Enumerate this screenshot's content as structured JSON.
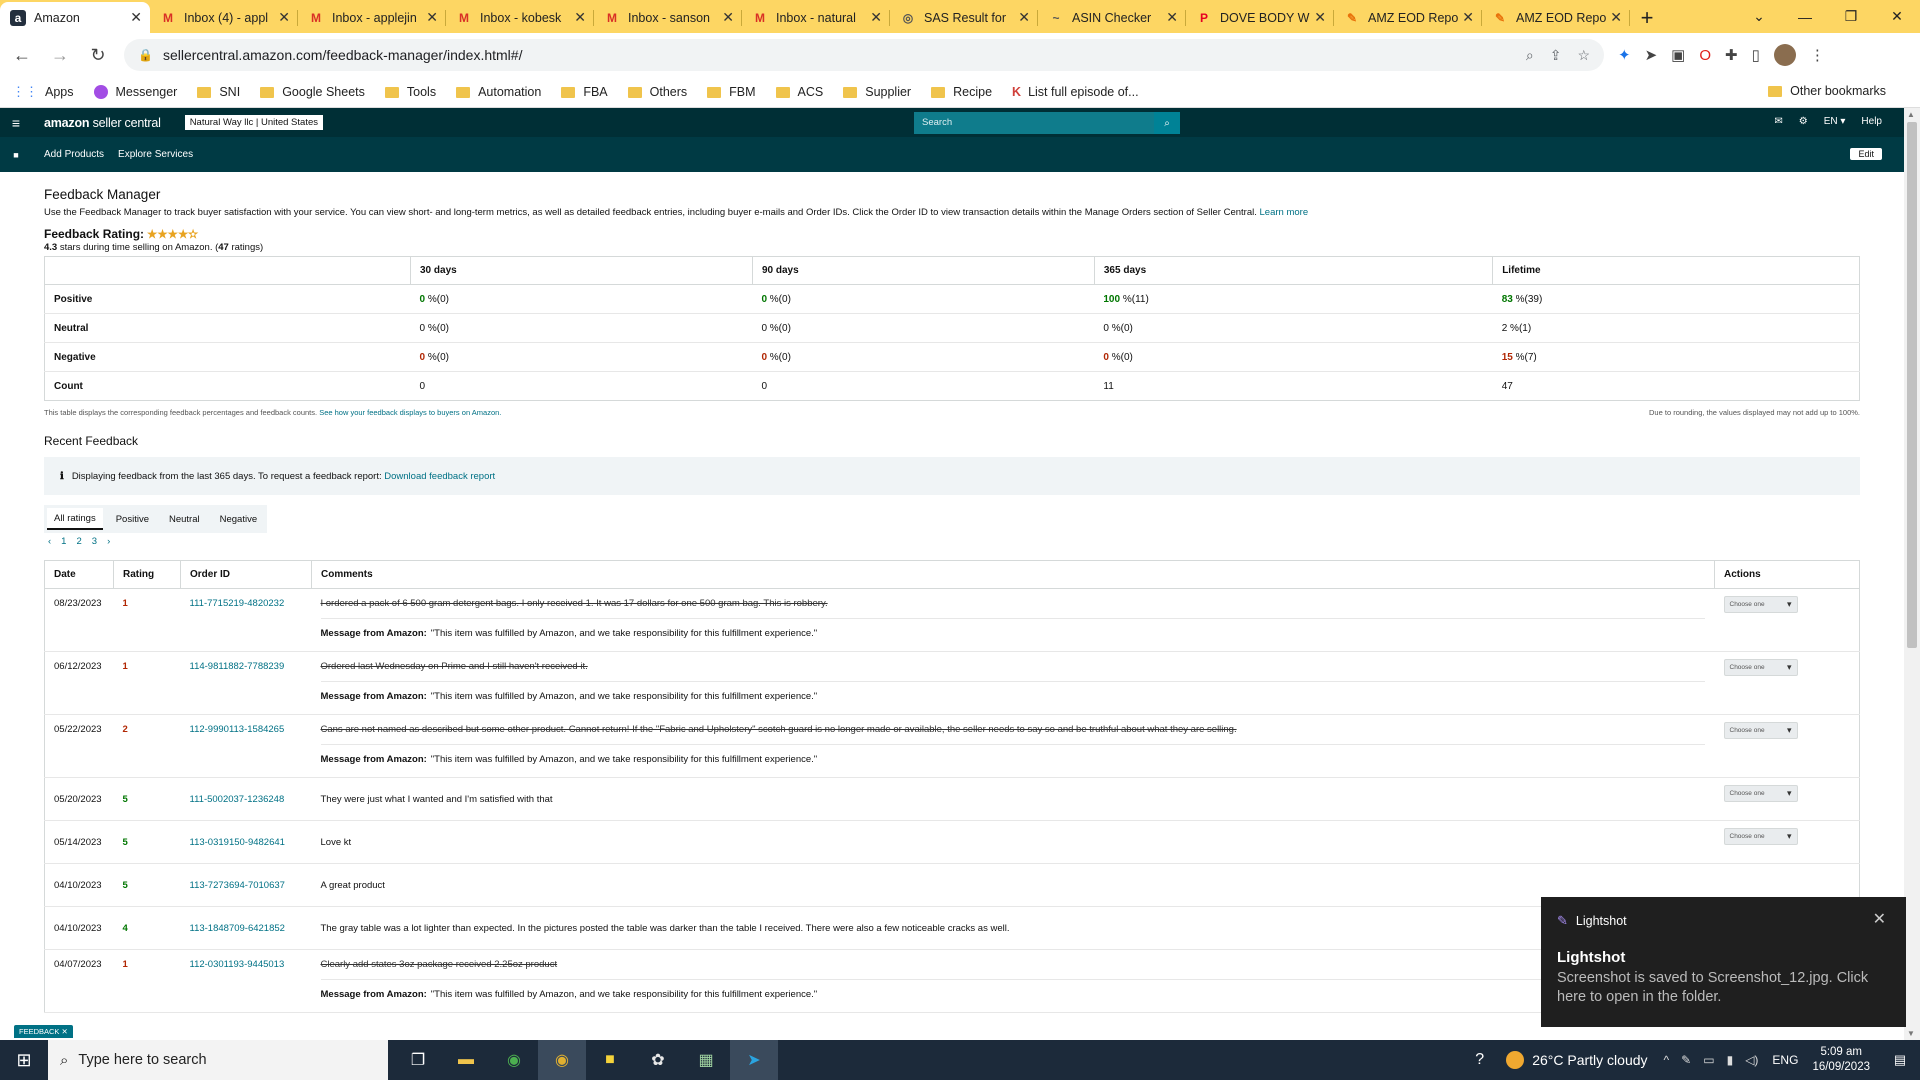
{
  "browser": {
    "tabs": [
      {
        "title": "Amazon",
        "icon": "amazon-favicon",
        "active": true
      },
      {
        "title": "Inbox (4) - appl",
        "icon": "gmail-icon"
      },
      {
        "title": "Inbox - applejin",
        "icon": "gmail-icon"
      },
      {
        "title": "Inbox - kobesk",
        "icon": "gmail-icon"
      },
      {
        "title": "Inbox - sanson",
        "icon": "gmail-icon"
      },
      {
        "title": "Inbox - natural",
        "icon": "gmail-icon"
      },
      {
        "title": "SAS Result for",
        "icon": "sas-icon"
      },
      {
        "title": "ASIN Checker",
        "icon": "asin-icon"
      },
      {
        "title": "DOVE BODY W",
        "icon": "pinterest-icon"
      },
      {
        "title": "AMZ EOD Repo",
        "icon": "sheets-icon"
      },
      {
        "title": "AMZ EOD Repo",
        "icon": "sheets-icon"
      }
    ],
    "url": "sellercentral.amazon.com/feedback-manager/index.html#/",
    "bookmarks": [
      "Apps",
      "Messenger",
      "SNI",
      "Google Sheets",
      "Tools",
      "Automation",
      "FBA",
      "Others",
      "FBM",
      "ACS",
      "Supplier",
      "Recipe",
      "List full episode of..."
    ],
    "other_bookmarks": "Other bookmarks"
  },
  "seller_header": {
    "logo_bold": "amazon",
    "logo_rest": " seller central",
    "account": "Natural Way llc | United States",
    "search_placeholder": "Search",
    "lang": "EN ▾",
    "help": "Help",
    "nav": [
      "Add Products",
      "Explore Services"
    ],
    "edit": "Edit"
  },
  "feedback_manager": {
    "title": "Feedback Manager",
    "description": "Use the Feedback Manager to track buyer satisfaction with your service. You can view short- and long-term metrics, as well as detailed feedback entries, including buyer e-mails and Order IDs. Click the Order ID to view transaction details within the Manage Orders section of Seller Central.",
    "learn_more": "Learn more",
    "rating_label": "Feedback Rating:",
    "rating_stars": 4.3,
    "rating_stars_glyphs": "★★★★✫",
    "rating_sub_value": "4.3",
    "rating_sub_text": " stars during time selling on Amazon. (",
    "rating_count": "47",
    "rating_sub_end": " ratings)"
  },
  "metrics": {
    "columns": [
      "30 days",
      "90 days",
      "365 days",
      "Lifetime"
    ],
    "rows": [
      {
        "label": "Positive",
        "cells": [
          [
            "0",
            "%(0)",
            "g"
          ],
          [
            "0",
            "%(0)",
            "g"
          ],
          [
            "100",
            "%(11)",
            "g"
          ],
          [
            "83",
            "%(39)",
            "g"
          ]
        ]
      },
      {
        "label": "Neutral",
        "cells": [
          [
            "0",
            "%(0)",
            ""
          ],
          [
            "0",
            "%(0)",
            ""
          ],
          [
            "0",
            "%(0)",
            ""
          ],
          [
            "2",
            "%(1)",
            ""
          ]
        ]
      },
      {
        "label": "Negative",
        "cells": [
          [
            "0",
            "%(0)",
            "r"
          ],
          [
            "0",
            "%(0)",
            "r"
          ],
          [
            "0",
            "%(0)",
            "r"
          ],
          [
            "15",
            "%(7)",
            "r"
          ]
        ]
      },
      {
        "label": "Count",
        "cells": [
          [
            "0",
            "",
            ""
          ],
          [
            "0",
            "",
            ""
          ],
          [
            "11",
            "",
            ""
          ],
          [
            "47",
            "",
            ""
          ]
        ]
      }
    ],
    "note": "This table displays the corresponding feedback percentages and feedback counts.",
    "note_link": "See how your feedback displays to buyers on Amazon.",
    "rounding": "Due to rounding, the values displayed may not add up to 100%."
  },
  "recent_feedback": {
    "title": "Recent Feedback",
    "info": "Displaying feedback from the last 365 days. To request a feedback report:",
    "info_link": "Download feedback report",
    "tabs": [
      "All ratings",
      "Positive",
      "Neutral",
      "Negative"
    ],
    "pager": [
      "‹",
      "1",
      "2",
      "3",
      "›"
    ],
    "columns": [
      "Date",
      "Rating",
      "Order ID",
      "Comments",
      "Actions"
    ],
    "amazon_msg_label": "Message from Amazon:",
    "amazon_msg": "\"This item was fulfilled by Amazon, and we take responsibility for this fulfillment experience.\"",
    "choose": "Choose one",
    "rows": [
      {
        "date": "08/23/2023",
        "rating": "1",
        "order": "111-7715219-4820232",
        "comment": "I ordered a pack of 6 500 gram detergent bags. I only received 1. It was 17 dollars for one 500 gram bag. This is robbery.",
        "struck": true,
        "amz": true,
        "action": true
      },
      {
        "date": "06/12/2023",
        "rating": "1",
        "order": "114-9811882-7788239",
        "comment": "Ordered last Wednesday on Prime and I still haven't received it.",
        "struck": true,
        "amz": true,
        "action": true
      },
      {
        "date": "05/22/2023",
        "rating": "2",
        "order": "112-9990113-1584265",
        "comment": "Cans are not named as described but some other product. Cannot return! If the \"Fabric and Upholstery\" scotch guard is no longer made or available, the seller needs to say so and be truthful about what they are selling.",
        "struck": true,
        "amz": true,
        "action": true
      },
      {
        "date": "05/20/2023",
        "rating": "5",
        "order": "111-5002037-1236248",
        "comment": "They were just what I wanted and I'm satisfied with that",
        "struck": false,
        "amz": false,
        "action": true
      },
      {
        "date": "05/14/2023",
        "rating": "5",
        "order": "113-0319150-9482641",
        "comment": "Love kt",
        "struck": false,
        "amz": false,
        "action": true
      },
      {
        "date": "04/10/2023",
        "rating": "5",
        "order": "113-7273694-7010637",
        "comment": "A great product",
        "struck": false,
        "amz": false,
        "action": false
      },
      {
        "date": "04/10/2023",
        "rating": "4",
        "order": "113-1848709-6421852",
        "comment": "The gray table was a lot lighter than expected. In the pictures posted the table was darker than the table I received. There were also a few noticeable cracks as well.",
        "struck": false,
        "amz": false,
        "action": false
      },
      {
        "date": "04/07/2023",
        "rating": "1",
        "order": "112-0301193-9445013",
        "comment": "Clearly add states 3oz package received 2.25oz product",
        "struck": true,
        "amz": true,
        "action": false
      }
    ]
  },
  "toast": {
    "app": "Lightshot",
    "title": "Lightshot",
    "message": "Screenshot is saved to Screenshot_12.jpg. Click here to open in the folder."
  },
  "feedback_tab": "FEEDBACK ✕",
  "taskbar": {
    "search_placeholder": "Type here to search",
    "weather": "26°C  Partly cloudy",
    "lang": "ENG",
    "time": "5:09 am",
    "date": "16/09/2023",
    "notif_count": "5",
    "telegram_badge": "658"
  },
  "colors": {
    "header_bg": "#002f36",
    "positive": "#007600",
    "negative": "#b12704",
    "link": "#007185",
    "tabbar": "#fdd663"
  }
}
